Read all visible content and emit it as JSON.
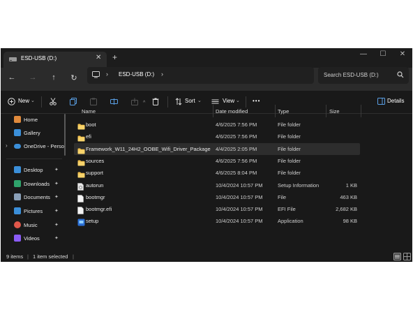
{
  "tab": {
    "title": "ESD-USB (D:)",
    "close": "✕",
    "new": "+"
  },
  "window_controls": {
    "minimize": "—",
    "maximize": "☐",
    "close": "✕"
  },
  "nav": {
    "back": "←",
    "forward": "→",
    "up": "↑",
    "refresh": "↻"
  },
  "address": {
    "crumb": "ESD-USB (D:)",
    "sep1": "›",
    "sep2": "›"
  },
  "search": {
    "placeholder": "Search ESD-USB (D:)"
  },
  "commands": {
    "new": "New",
    "sort": "Sort",
    "view": "View",
    "more": "•••",
    "details": "Details"
  },
  "sidebar": {
    "items": [
      {
        "label": "Home",
        "icon": "home-icon",
        "color": "#e08a3c"
      },
      {
        "label": "Gallery",
        "icon": "gallery-icon",
        "color": "#3b8fd9"
      },
      {
        "label": "OneDrive - Perso",
        "icon": "onedrive-icon",
        "color": "#3b8fd9"
      },
      {
        "label": "Desktop",
        "icon": "desktop-icon",
        "color": "#3b8fd9"
      },
      {
        "label": "Downloads",
        "icon": "downloads-icon",
        "color": "#2fa36b"
      },
      {
        "label": "Documents",
        "icon": "documents-icon",
        "color": "#8aa0b8"
      },
      {
        "label": "Pictures",
        "icon": "pictures-icon",
        "color": "#3b8fd9"
      },
      {
        "label": "Music",
        "icon": "music-icon",
        "color": "#e0574a"
      },
      {
        "label": "Videos",
        "icon": "videos-icon",
        "color": "#8b5cf6"
      }
    ],
    "pin": "✦"
  },
  "columns": {
    "name": "Name",
    "date": "Date modified",
    "type": "Type",
    "size": "Size"
  },
  "files": [
    {
      "name": "boot",
      "date": "4/6/2025 7:56 PM",
      "type": "File folder",
      "size": "",
      "kind": "folder"
    },
    {
      "name": "efi",
      "date": "4/6/2025 7:56 PM",
      "type": "File folder",
      "size": "",
      "kind": "folder"
    },
    {
      "name": "Framework_W11_24H2_OOBE_Wifi_Driver_Package",
      "date": "4/4/2025 2:05 PM",
      "type": "File folder",
      "size": "",
      "kind": "folder",
      "selected": true
    },
    {
      "name": "sources",
      "date": "4/6/2025 7:56 PM",
      "type": "File folder",
      "size": "",
      "kind": "folder"
    },
    {
      "name": "support",
      "date": "4/6/2025 8:04 PM",
      "type": "File folder",
      "size": "",
      "kind": "folder"
    },
    {
      "name": "autorun",
      "date": "10/4/2024 10:57 PM",
      "type": "Setup Information",
      "size": "1 KB",
      "kind": "inf"
    },
    {
      "name": "bootmgr",
      "date": "10/4/2024 10:57 PM",
      "type": "File",
      "size": "463 KB",
      "kind": "file"
    },
    {
      "name": "bootmgr.efi",
      "date": "10/4/2024 10:57 PM",
      "type": "EFI File",
      "size": "2,682 KB",
      "kind": "file"
    },
    {
      "name": "setup",
      "date": "10/4/2024 10:57 PM",
      "type": "Application",
      "size": "98 KB",
      "kind": "app"
    }
  ],
  "status": {
    "items": "9 items",
    "divider": "|",
    "selected": "1 item selected"
  }
}
